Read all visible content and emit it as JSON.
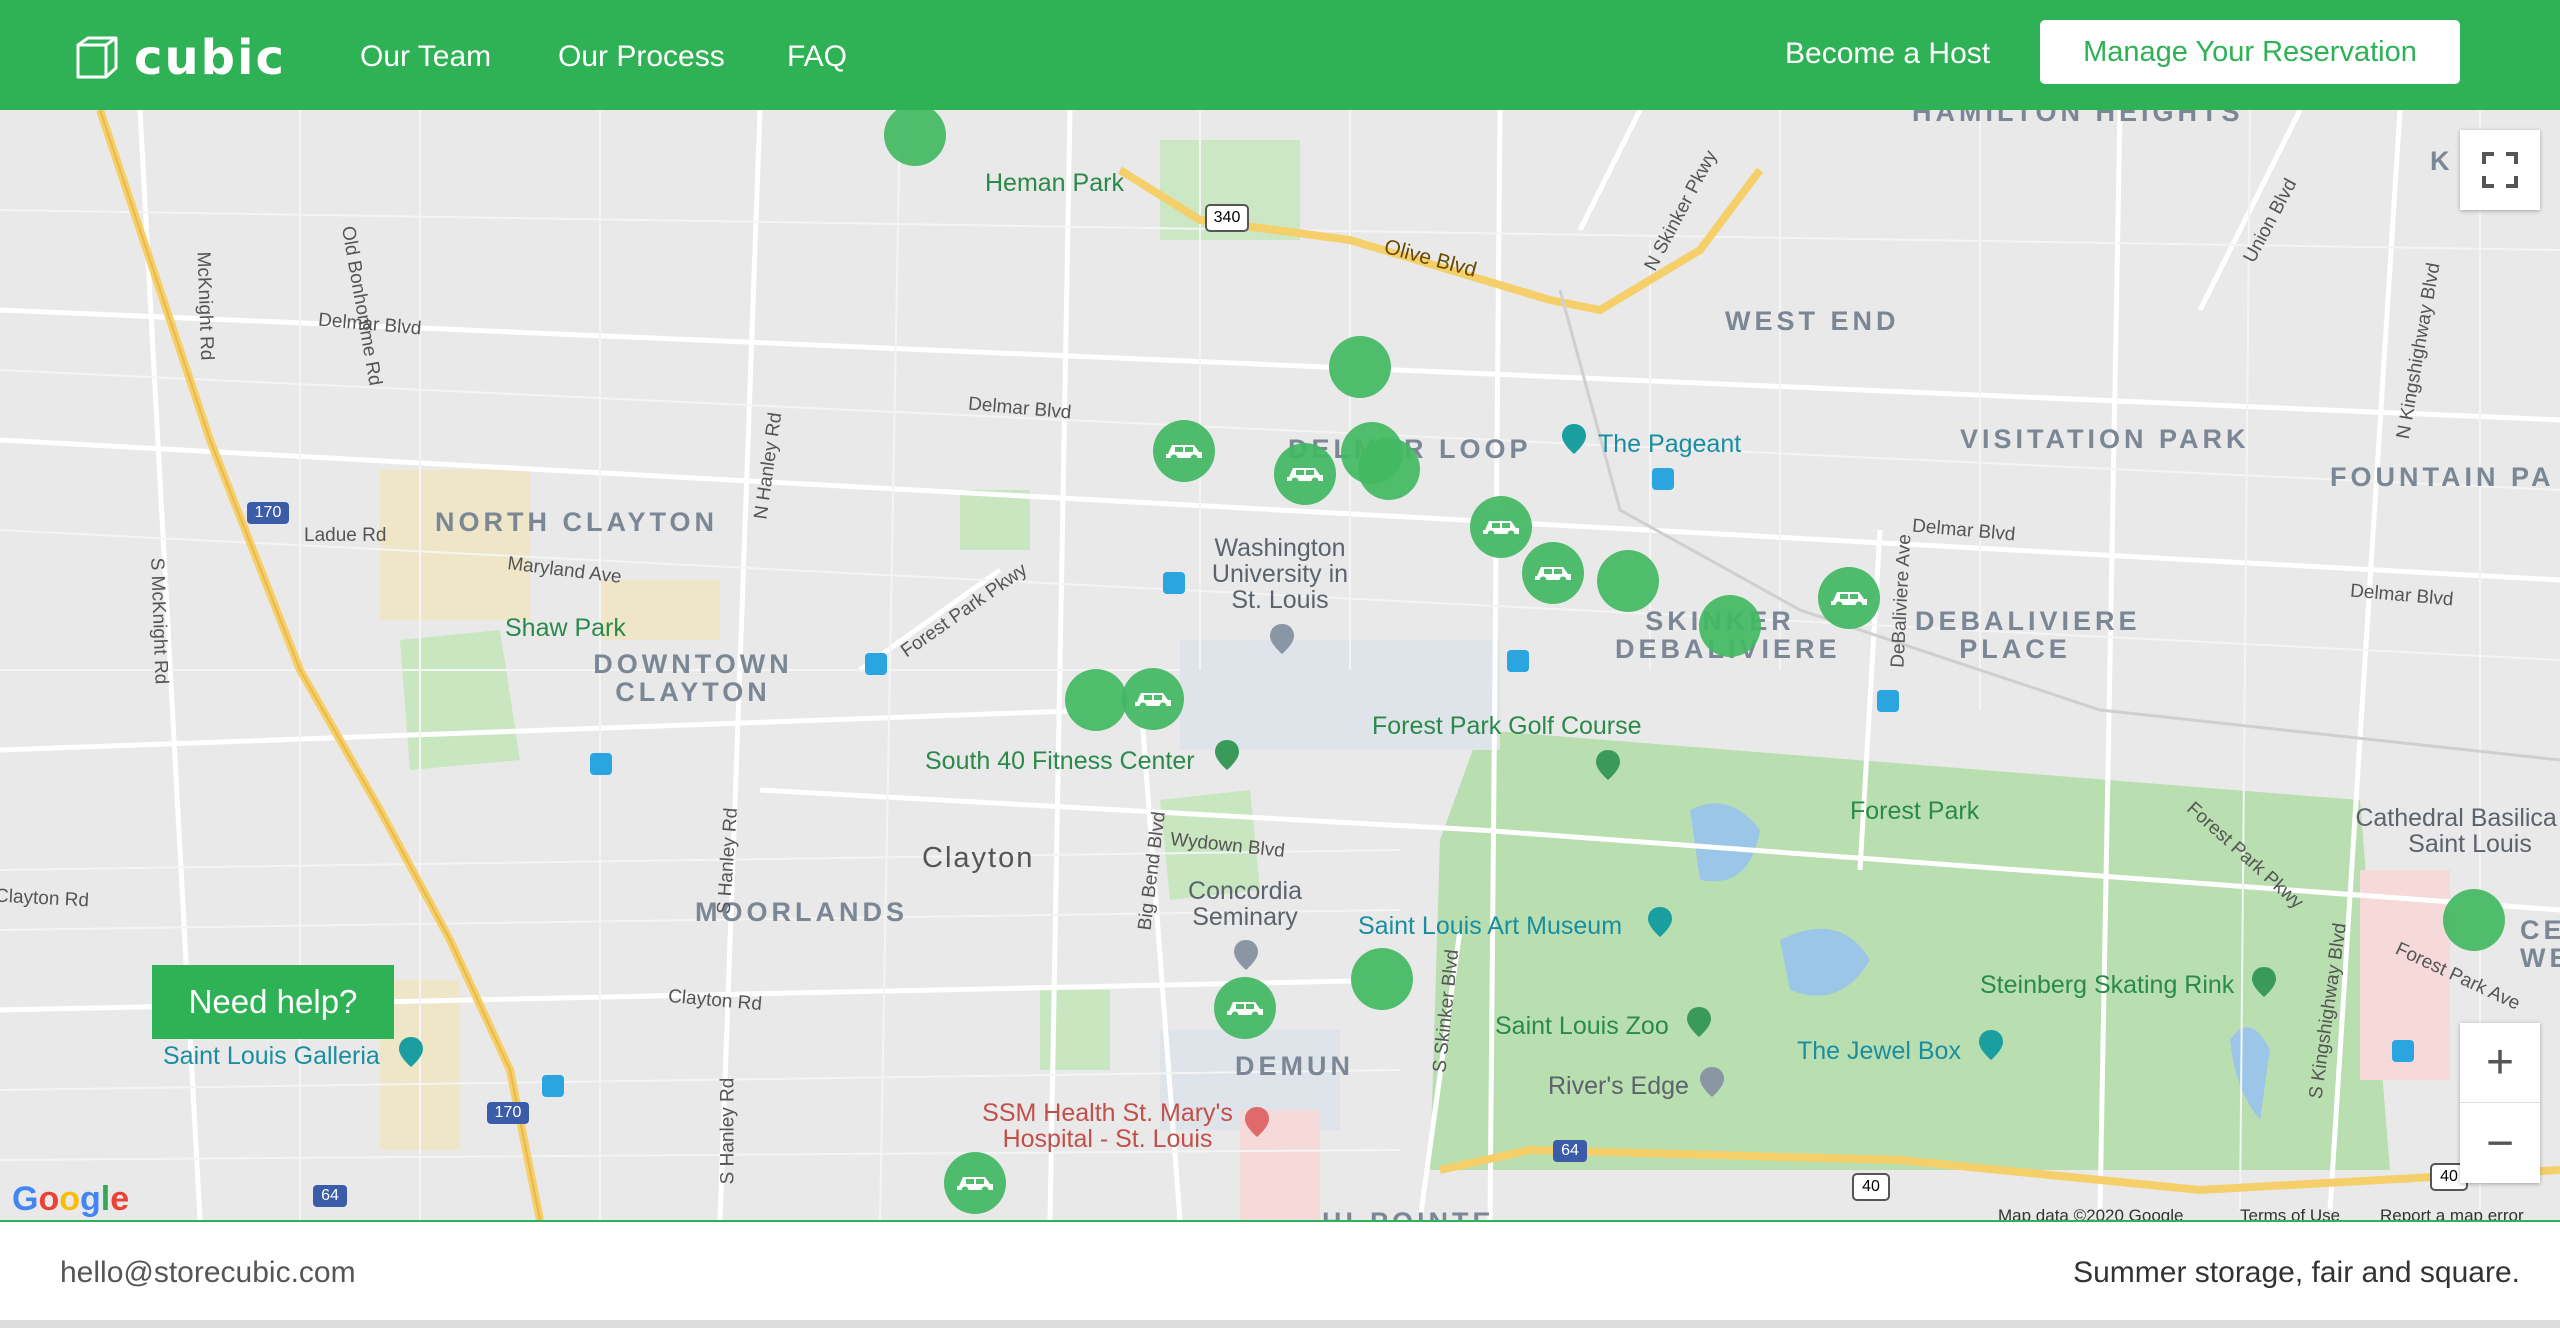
{
  "header": {
    "logo_text": "cubic",
    "nav": [
      "Our Team",
      "Our Process",
      "FAQ"
    ],
    "host_link": "Become a Host",
    "manage_button": "Manage Your Reservation",
    "brand_color": "#2fb156"
  },
  "map": {
    "neighborhoods": [
      "HAMILTON HEIGHTS",
      "WEST END",
      "DELMAR LOOP",
      "VISITATION PARK",
      "FOUNTAIN PA",
      "NORTH CLAYTON",
      "DOWNTOWN CLAYTON",
      "SKINKER DEBALIVIERE",
      "DEBALIVIERE PLACE",
      "MOORLANDS",
      "DEMUN",
      "HI-POINTE",
      "CEN WES",
      "K W"
    ],
    "places": [
      "Heman Park",
      "The Pageant",
      "Washington University in St. Louis",
      "Shaw Park",
      "Forest Park Golf Course",
      "South 40 Fitness Center",
      "Forest Park",
      "Cathedral Basilica of Saint Louis",
      "Concordia Seminary",
      "Saint Louis Art Museum",
      "Steinberg Skating Rink",
      "Saint Louis Zoo",
      "The Jewel Box",
      "River's Edge",
      "Saint Louis Galleria",
      "SSM Health St. Mary's Hospital - St. Louis"
    ],
    "city": "Clayton",
    "streets": [
      "Olive Blvd",
      "N Skinker Pkwy",
      "Union Blvd",
      "N Kingshighway Blvd",
      "Delmar Blvd",
      "Delmar Blvd",
      "Delmar Blvd",
      "Delmar Blvd",
      "Ladue Rd",
      "Maryland Ave",
      "Forest Park Pkwy",
      "N Hanley Rd",
      "S Hanley Rd",
      "S Hanley Rd",
      "Big Bend Blvd",
      "Wydown Blvd",
      "Clayton Rd",
      "Clayton Rd",
      "S Skinker Blvd",
      "S Kingshighway Blvd",
      "Forest Park Ave",
      "Forest Park Pkwy",
      "McKnight Rd",
      "S McKnight Rd",
      "Old Bonhomme Rd",
      "DeBaliviere Ave"
    ],
    "highway_shields": [
      "340",
      "170",
      "170",
      "64",
      "64",
      "40",
      "40"
    ],
    "controls": {
      "fullscreen": "fullscreen-icon",
      "zoom_in": "+",
      "zoom_out": "−"
    },
    "google_logo": "Google",
    "attribution": [
      "Map data ©2020 Google",
      "Terms of Use",
      "Report a map error"
    ],
    "marker_color": "#42b862"
  },
  "need_help": "Need help?",
  "footer": {
    "email": "hello@storecubic.com",
    "slogan": "Summer storage, fair and square."
  }
}
